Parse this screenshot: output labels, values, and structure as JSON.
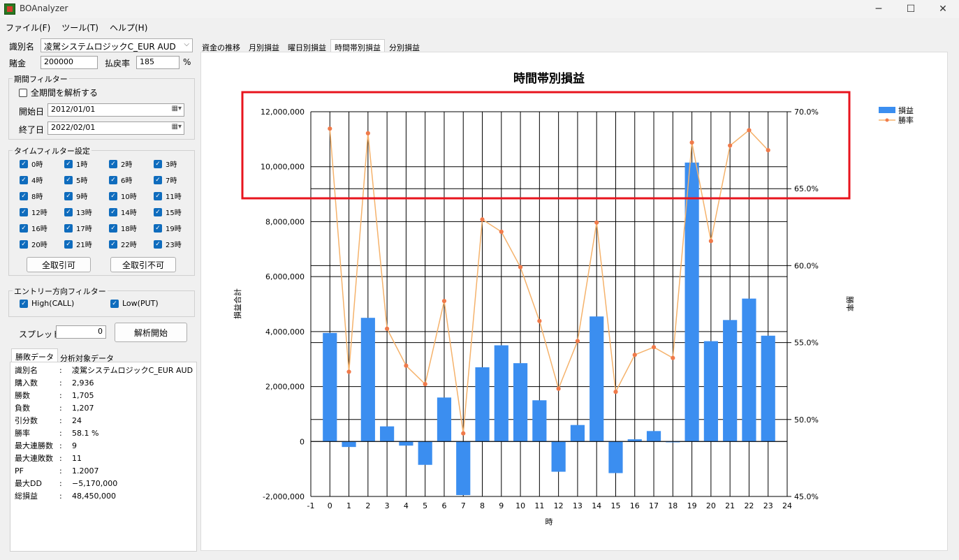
{
  "window": {
    "title": "BOAnalyzer",
    "minimize": "─",
    "maximize": "☐",
    "close": "✕"
  },
  "menu": [
    "ファイル(F)",
    "ツール(T)",
    "ヘルプ(H)"
  ],
  "left": {
    "id_label": "識別名",
    "id_value": "凌駕システムロジックC_EUR AUD",
    "stake_label": "賭金",
    "stake_value": "200000",
    "payout_label": "払戻率",
    "payout_value": "185",
    "payout_unit": "%",
    "period_group": "期間フィルター",
    "all_period_label": "全期間を解析する",
    "all_period_checked": false,
    "start_label": "開始日",
    "start_value": "2012/01/01",
    "end_label": "終了日",
    "end_value": "2022/02/01",
    "time_group": "タイムフィルター設定",
    "hours": [
      "0時",
      "1時",
      "2時",
      "3時",
      "4時",
      "5時",
      "6時",
      "7時",
      "8時",
      "9時",
      "10時",
      "11時",
      "12時",
      "13時",
      "14時",
      "15時",
      "16時",
      "17時",
      "18時",
      "19時",
      "20時",
      "21時",
      "22時",
      "23時"
    ],
    "allow_all": "全取引可",
    "deny_all": "全取引不可",
    "entry_group": "エントリー方向フィルター",
    "high_label": "High(CALL)",
    "low_label": "Low(PUT)",
    "spread_label": "スプレッド",
    "spread_value": "0",
    "start_button": "解析開始",
    "tab_results": "勝敗データ",
    "tab_target": "分析対象データ",
    "stats": [
      {
        "k": "識別名",
        "v": "凌駕システムロジックC_EUR AUD"
      },
      {
        "k": "購入数",
        "v": "2,936"
      },
      {
        "k": "勝数",
        "v": "1,705"
      },
      {
        "k": "負数",
        "v": "1,207"
      },
      {
        "k": "引分数",
        "v": "24"
      },
      {
        "k": "勝率",
        "v": "58.1 %"
      },
      {
        "k": "最大連勝数",
        "v": "9"
      },
      {
        "k": "最大連敗数",
        "v": "11"
      },
      {
        "k": "PF",
        "v": "1.2007"
      },
      {
        "k": "最大DD",
        "v": "−5,170,000"
      },
      {
        "k": "総損益",
        "v": "48,450,000"
      }
    ],
    "colon": ":"
  },
  "tabs": [
    "資金の推移",
    "月別損益",
    "曜日別損益",
    "時間帯別損益",
    "分別損益"
  ],
  "active_tab": 3,
  "colors": {
    "bar": "#3b8ef0",
    "line": "#f5b26b",
    "marker": "#f07a4a",
    "highlight": "#e8141e",
    "checkbox": "#0f6cbd"
  },
  "chart_data": {
    "type": "bar",
    "title": "時間帯別損益",
    "xlabel": "時",
    "ylabel": "損益合計",
    "y2label": "勝率",
    "x": [
      0,
      1,
      2,
      3,
      4,
      5,
      6,
      7,
      8,
      9,
      10,
      11,
      12,
      13,
      14,
      15,
      16,
      17,
      18,
      19,
      20,
      21,
      22,
      23
    ],
    "xticks": [
      "-1",
      "0",
      "1",
      "2",
      "3",
      "4",
      "5",
      "6",
      "7",
      "8",
      "9",
      "10",
      "11",
      "12",
      "13",
      "14",
      "15",
      "16",
      "17",
      "18",
      "19",
      "20",
      "21",
      "22",
      "23",
      "24"
    ],
    "xlim": [
      -1,
      24
    ],
    "ylim": [
      -2000000,
      12000000
    ],
    "yticks": [
      "-2,000,000",
      "0",
      "2,000,000",
      "4,000,000",
      "6,000,000",
      "8,000,000",
      "10,000,000",
      "12,000,000"
    ],
    "y2lim": [
      45,
      70
    ],
    "y2ticks": [
      "45.0%",
      "50.0%",
      "55.0%",
      "60.0%",
      "65.0%",
      "70.0%"
    ],
    "legend_position": "top-right",
    "grid": true,
    "series": [
      {
        "name": "損益",
        "kind": "bar",
        "values": [
          3950000,
          -200000,
          4500000,
          550000,
          -150000,
          -850000,
          1600000,
          -1950000,
          2700000,
          3500000,
          2850000,
          1500000,
          -1100000,
          600000,
          4550000,
          -1150000,
          80000,
          380000,
          -30000,
          10150000,
          3650000,
          4420000,
          5200000,
          3850000
        ]
      },
      {
        "name": "勝率",
        "kind": "line",
        "axis": "right",
        "values": [
          68.9,
          53.1,
          68.6,
          55.9,
          53.5,
          52.3,
          57.7,
          49.1,
          63.0,
          62.2,
          59.9,
          56.4,
          52.0,
          55.1,
          62.8,
          51.8,
          54.2,
          54.7,
          54.0,
          68.0,
          61.6,
          67.8,
          68.8,
          67.5
        ]
      }
    ]
  }
}
